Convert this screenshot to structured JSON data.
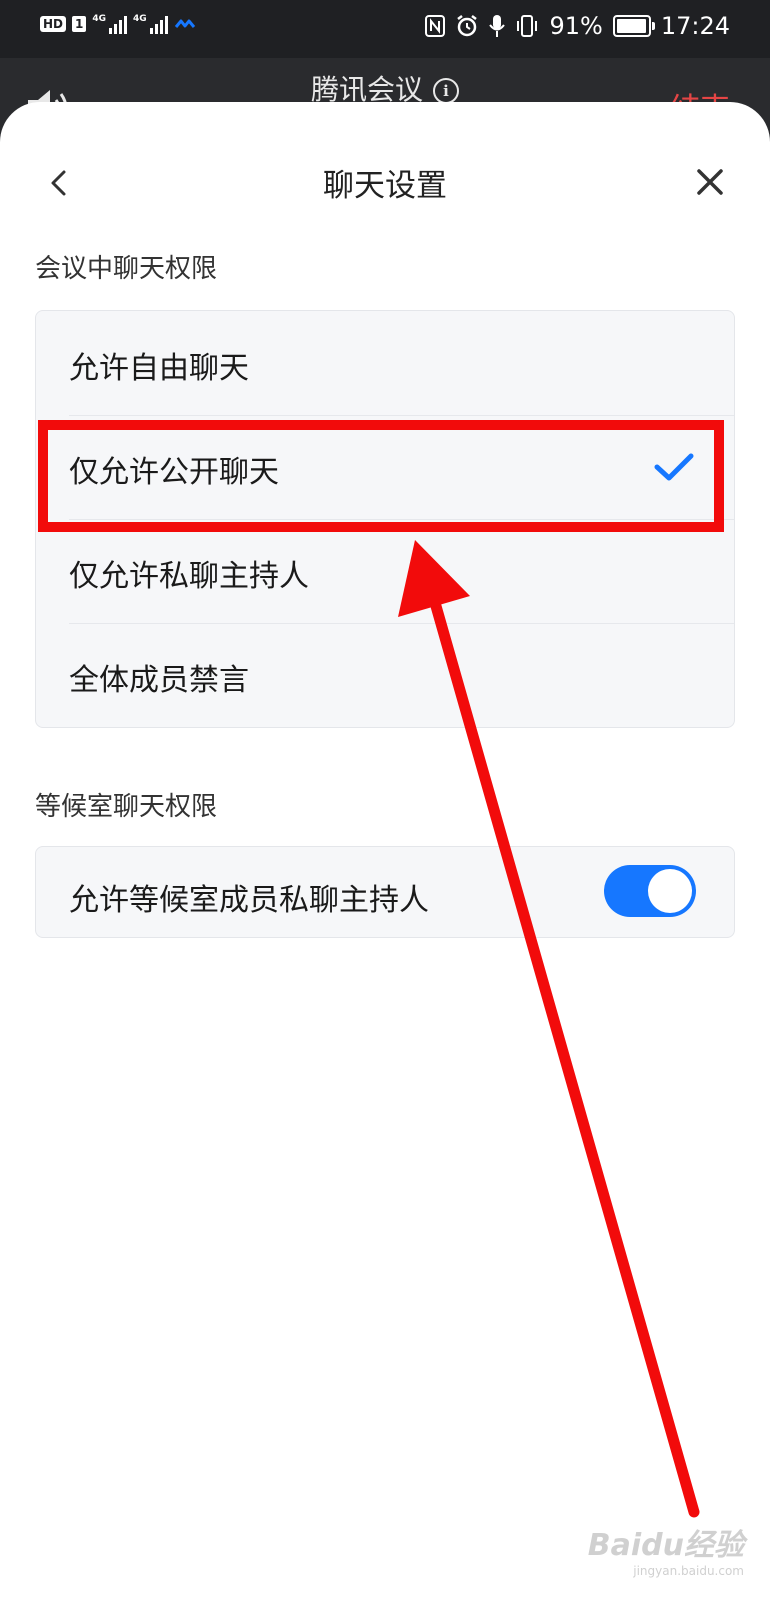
{
  "status_bar": {
    "hd_badge": "HD",
    "sim_number": "1",
    "signal1_net": "4G",
    "signal2_net": "4G",
    "battery_percent": "91%",
    "time": "17:24"
  },
  "meeting_bar": {
    "title": "腾讯会议",
    "end_label": "结束"
  },
  "sheet": {
    "title": "聊天设置"
  },
  "meeting_chat": {
    "section_label": "会议中聊天权限",
    "options": [
      {
        "label": "允许自由聊天",
        "selected": false
      },
      {
        "label": "仅允许公开聊天",
        "selected": true
      },
      {
        "label": "仅允许私聊主持人",
        "selected": false
      },
      {
        "label": "全体成员禁言",
        "selected": false
      }
    ]
  },
  "waiting_room_chat": {
    "section_label": "等候室聊天权限",
    "toggle_label": "允许等候室成员私聊主持人",
    "toggle_on": true
  },
  "watermark": {
    "brand": "Baidu经验",
    "url": "jingyan.baidu.com"
  },
  "colors": {
    "accent": "#1677ff",
    "annotation_red": "#f20b0b",
    "end_red": "#e54545"
  }
}
